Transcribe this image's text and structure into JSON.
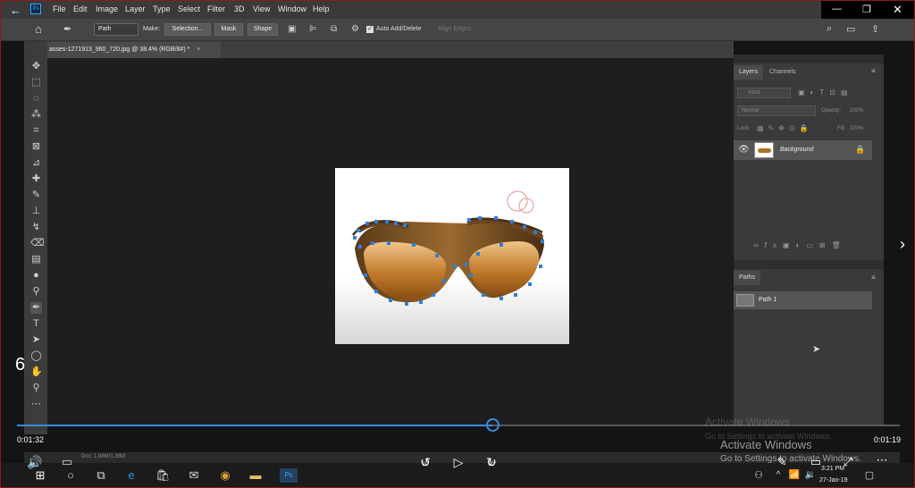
{
  "menu": {
    "items": [
      "File",
      "Edit",
      "Image",
      "Layer",
      "Type",
      "Select",
      "Filter",
      "3D",
      "View",
      "Window",
      "Help"
    ],
    "app_icon": "Ps"
  },
  "options": {
    "mode": "Path",
    "make_label": "Make:",
    "selection_btn": "Selection...",
    "mask_btn": "Mask",
    "shape_btn": "Shape",
    "auto_add_delete": "Auto Add/Delete",
    "align_edges": "Align Edges"
  },
  "document": {
    "tab_title": "asses-1271913_960_720.jpg @ 38.4% (RGB/8#) *",
    "status": "Doc: 1.98M/1.36M"
  },
  "layers_panel": {
    "tabs": [
      "Layers",
      "Channels"
    ],
    "kind_placeholder": "Kind",
    "blend_mode": "Normal",
    "opacity_label": "Opacity:",
    "opacity_value": "100%",
    "lock_label": "Lock:",
    "fill_label": "Fill:",
    "fill_value": "100%",
    "layer_name": "Background"
  },
  "paths_panel": {
    "tab": "Paths",
    "path_name": "Path 1"
  },
  "player": {
    "side_number": "6",
    "elapsed": "0:01:32",
    "total": "0:01:19",
    "progress": 0.538,
    "rewind_label": "10",
    "forward_label": "30"
  },
  "watermark": {
    "title": "Activate Windows",
    "subtitle": "Go to Settings to activate Windows."
  },
  "taskbar": {
    "time": "3:21 PM",
    "date": "27-Jan-19"
  },
  "colors": {
    "accent": "#3b8be0",
    "path_point": "#2f7fd6",
    "frame_border": "#8b1a1a"
  }
}
